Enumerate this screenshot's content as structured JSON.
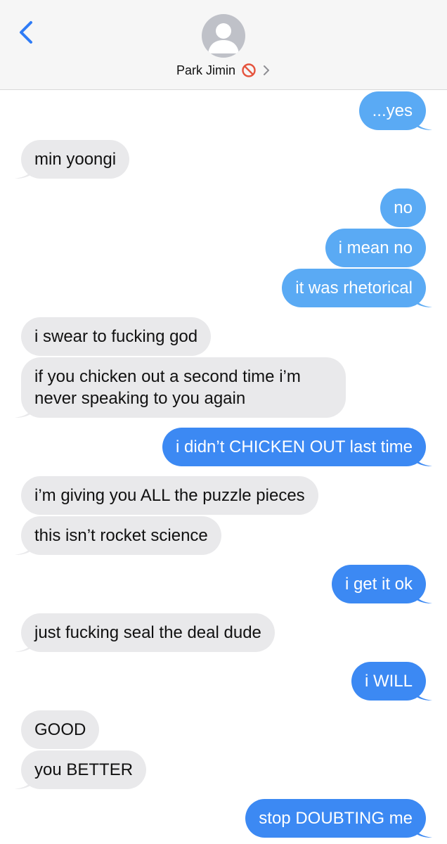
{
  "header": {
    "contact_name": "Park Jimin",
    "back_icon": "chevron-left-icon",
    "status_icon": "blocked-icon",
    "disclosure_icon": "chevron-right-icon",
    "colors": {
      "accent": "#2f7cf6",
      "header_bg": "#f6f6f6",
      "blocked": "#e5533d"
    }
  },
  "colors": {
    "incoming_bubble": "#e9e9eb",
    "outgoing_bubble_light": "#5aaaf4",
    "outgoing_bubble": "#3c89f3"
  },
  "messages": [
    {
      "dir": "out",
      "text": "...yes"
    },
    {
      "dir": "in",
      "text": "min yoongi"
    },
    {
      "dir": "out",
      "text": "no"
    },
    {
      "dir": "out",
      "text": "i mean no"
    },
    {
      "dir": "out",
      "text": "it was rhetorical"
    },
    {
      "dir": "in",
      "text": "i swear to fucking god"
    },
    {
      "dir": "in",
      "text": "if you chicken out a second time i’m never speaking to you again"
    },
    {
      "dir": "out",
      "text": "i didn’t CHICKEN OUT last time"
    },
    {
      "dir": "in",
      "text": "i’m giving you ALL the puzzle pieces"
    },
    {
      "dir": "in",
      "text": "this isn’t rocket science"
    },
    {
      "dir": "out",
      "text": "i get it ok"
    },
    {
      "dir": "in",
      "text": "just fucking seal the deal dude"
    },
    {
      "dir": "out",
      "text": "i WILL"
    },
    {
      "dir": "in",
      "text": "GOOD"
    },
    {
      "dir": "in",
      "text": "you BETTER"
    },
    {
      "dir": "out",
      "text": "stop DOUBTING me"
    }
  ]
}
